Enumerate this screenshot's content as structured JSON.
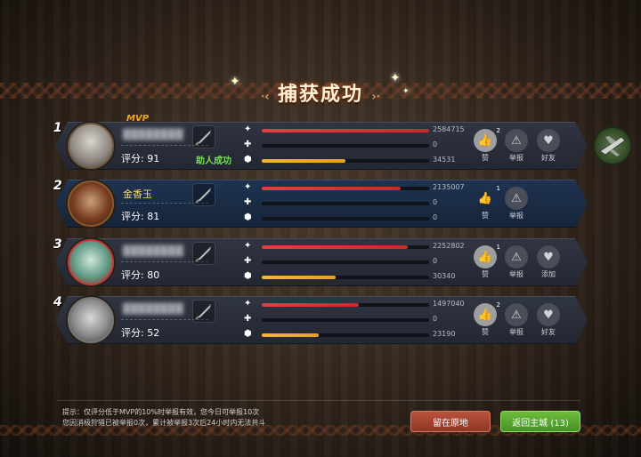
{
  "title": "捕获成功",
  "colors": {
    "mvp": "#f4a623",
    "assist": "#78e05a",
    "damage": "#e04040",
    "shield": "#f4b53a",
    "stay_button": "#b9523c",
    "back_button": "#6cbd3a"
  },
  "players": [
    {
      "rank": "1",
      "mvp_label": "MVP",
      "name": "",
      "score_text": "评分: 91",
      "assist_text": "助人成功",
      "damage": "2584715",
      "damage_fraction": 1.0,
      "heal": "0",
      "heal_fraction": 0,
      "shield": "34531",
      "shield_fraction": 0.5,
      "like_label": "赞",
      "like_count": "2",
      "liked": true,
      "report_label": "举报",
      "friend_label": "好友"
    },
    {
      "rank": "2",
      "name": "金香玉",
      "score_text": "评分: 81",
      "damage": "2135007",
      "damage_fraction": 0.83,
      "heal": "0",
      "heal_fraction": 0,
      "shield": "0",
      "shield_fraction": 0,
      "like_label": "赞",
      "like_count": "1",
      "liked": false,
      "report_label": "举报"
    },
    {
      "rank": "3",
      "name": "",
      "score_text": "评分: 80",
      "damage": "2252802",
      "damage_fraction": 0.87,
      "heal": "0",
      "heal_fraction": 0,
      "shield": "30340",
      "shield_fraction": 0.44,
      "like_label": "赞",
      "like_count": "1",
      "liked": true,
      "report_label": "举报",
      "friend_label": "添加"
    },
    {
      "rank": "4",
      "name": "",
      "score_text": "评分: 52",
      "damage": "1497040",
      "damage_fraction": 0.58,
      "heal": "0",
      "heal_fraction": 0,
      "shield": "23190",
      "shield_fraction": 0.34,
      "like_label": "赞",
      "like_count": "2",
      "liked": true,
      "report_label": "举报",
      "friend_label": "好友"
    }
  ],
  "tip_line1": "提示：仅评分低于MVP的10%时举报有效，您今日可举报10次",
  "tip_line2": "您因消极狩猎已被举报0次，累计被举报3次后24小时内无法共斗",
  "stay_button": "留在原地",
  "back_button": "返回主城 (13)"
}
